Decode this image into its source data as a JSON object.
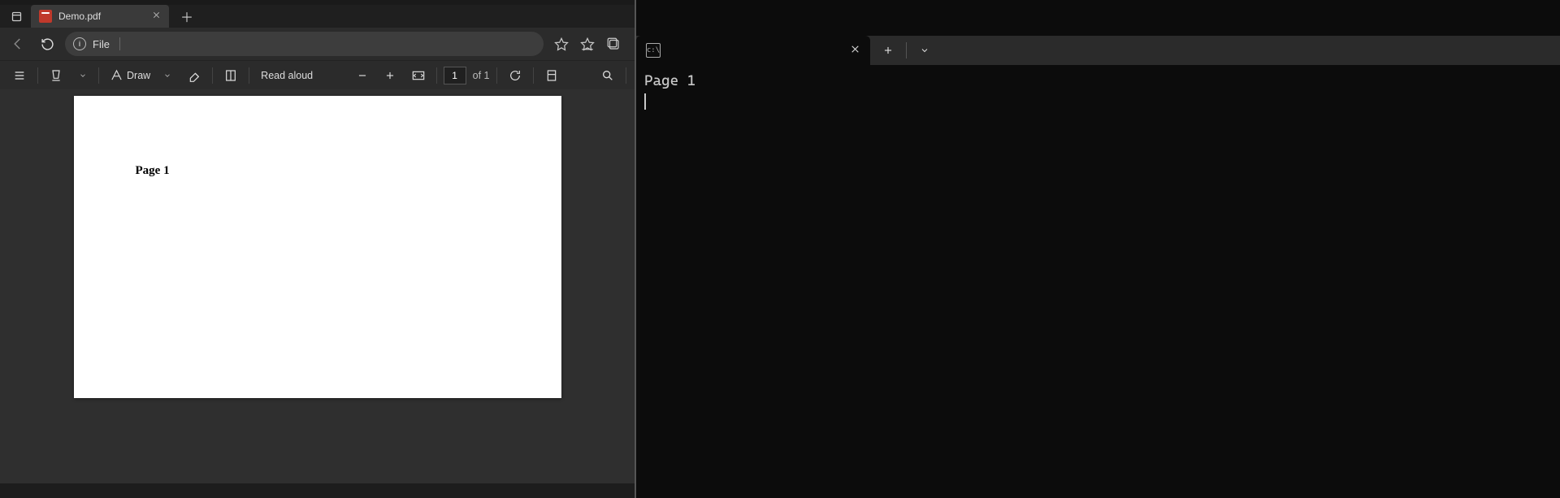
{
  "browser": {
    "tab": {
      "title": "Demo.pdf"
    },
    "address": {
      "label": "File"
    },
    "pdf_toolbar": {
      "draw_label": "Draw",
      "read_aloud_label": "Read aloud",
      "page_input_value": "1",
      "page_count_label": "of 1"
    },
    "page_content": {
      "heading": "Page 1"
    }
  },
  "terminal": {
    "output_line1": "Page 1"
  }
}
